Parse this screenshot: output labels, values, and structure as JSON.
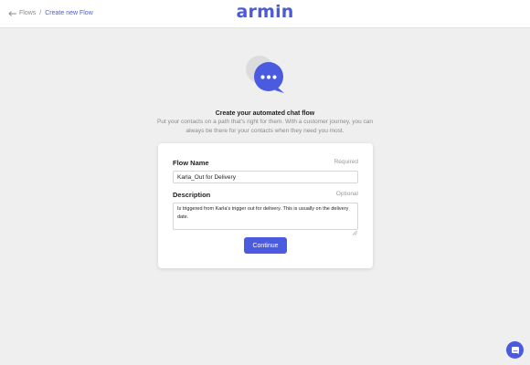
{
  "header": {
    "logo_text": "armin",
    "breadcrumb": {
      "back_icon": "arrow-left-icon",
      "root": "Flows",
      "separator": "/",
      "current": "Create new Flow"
    }
  },
  "hero": {
    "icon": "chat-bubbles-icon",
    "title": "Create your automated chat flow",
    "subtitle": "Put your contacts on a path that's right for them. With a customer journey, you can always be there for your contacts when they need you most."
  },
  "form": {
    "name": {
      "label": "Flow Name",
      "hint": "Required",
      "value": "Karla_Out for Delivery"
    },
    "description": {
      "label": "Description",
      "hint": "Optional",
      "value": "Is triggered from Karla's trigger out for delivery. This is usually on the delivery date."
    },
    "continue_label": "Continue"
  },
  "chat_widget": {
    "icon": "chat-launcher-icon"
  },
  "colors": {
    "brand": "#4b5be0",
    "background": "#efefef",
    "card": "#ffffff"
  }
}
